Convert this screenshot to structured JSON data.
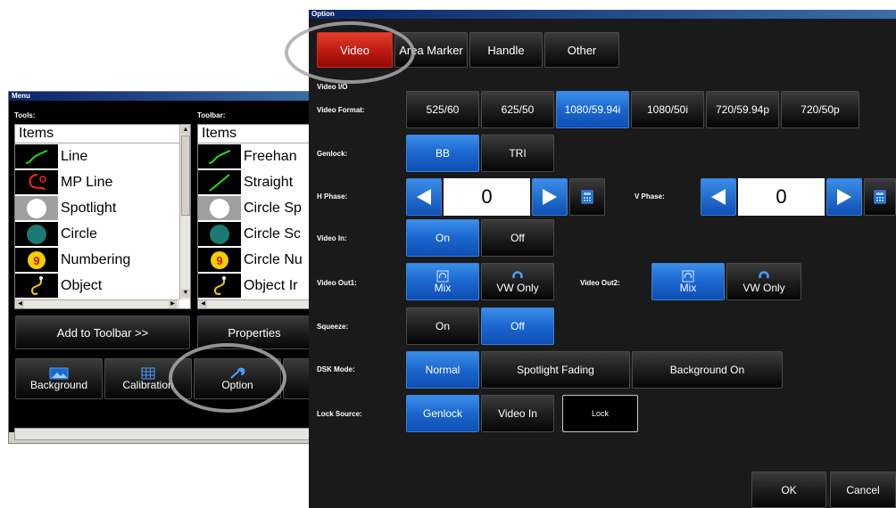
{
  "menu": {
    "title": "Menu",
    "tools_label": "Tools:",
    "toolbar_label": "Toolbar:",
    "items_header": "Items",
    "tools_items": [
      "Line",
      "MP Line",
      "Spotlight",
      "Circle",
      "Numbering",
      "Object"
    ],
    "toolbar_items": [
      "Freehan",
      "Straight",
      "Circle Sp",
      "Circle Sc",
      "Circle Nu",
      "Object Ir"
    ],
    "add_to_toolbar": "Add to Toolbar >>",
    "properties": "Properties",
    "background": "Background",
    "calibration": "Calibration",
    "option": "Option"
  },
  "option": {
    "title": "Option",
    "tabs": [
      "Video",
      "Area Marker",
      "Handle",
      "Other"
    ],
    "section_video_io": "Video I/O",
    "video_format_label": "Video Format:",
    "video_formats": [
      "525/60",
      "625/50",
      "1080/59.94i",
      "1080/50i",
      "720/59.94p",
      "720/50p"
    ],
    "genlock_label": "Genlock:",
    "genlock_options": [
      "BB",
      "TRI"
    ],
    "h_phase_label": "H Phase:",
    "h_phase_value": "0",
    "v_phase_label": "V Phase:",
    "v_phase_value": "0",
    "video_in_label": "Video In:",
    "on": "On",
    "off": "Off",
    "video_out1_label": "Video Out1:",
    "video_out2_label": "Video Out2:",
    "mix": "Mix",
    "vw_only": "VW Only",
    "squeeze_label": "Squeeze:",
    "dsk_label": "DSK Mode:",
    "dsk_options": [
      "Normal",
      "Spotlight Fading",
      "Background On"
    ],
    "lock_source_label": "Lock Source:",
    "lock_options": [
      "Genlock",
      "Video In"
    ],
    "lock_button": "Lock",
    "ok": "OK",
    "cancel": "Cancel"
  },
  "colors": {
    "selected_blue": "#1b66cf",
    "active_red": "#bc1a12",
    "panel_bg": "#1a1a1a"
  }
}
